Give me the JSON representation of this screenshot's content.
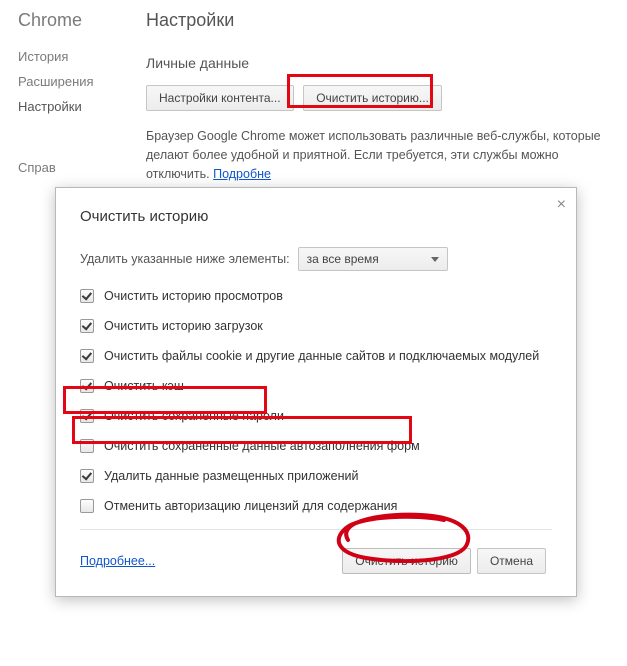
{
  "app_name": "Chrome",
  "page_title": "Настройки",
  "sidebar": {
    "items": [
      {
        "label": "История"
      },
      {
        "label": "Расширения"
      },
      {
        "label": "Настройки"
      }
    ],
    "footer_item": {
      "label": "Справ"
    }
  },
  "personal": {
    "section_title": "Личные данные",
    "btn_content": "Настройки контента...",
    "btn_clear": "Очистить историю...",
    "description_1": "Браузер Google Chrome может использовать различные веб-службы, которые делают",
    "description_2": "более удобной и приятной. Если требуется, эти службы можно отключить. ",
    "more_link": "Подробне"
  },
  "dialog": {
    "title": "Очистить историю",
    "delete_label": "Удалить указанные ниже элементы:",
    "range_value": "за все время",
    "checks": [
      {
        "label": "Очистить историю просмотров",
        "checked": true
      },
      {
        "label": "Очистить историю загрузок",
        "checked": true
      },
      {
        "label": "Очистить файлы cookie и другие данные сайтов и подключаемых модулей",
        "checked": true
      },
      {
        "label": "Очистить кэш",
        "checked": true
      },
      {
        "label": "Очистить сохраненные пароли",
        "checked": true
      },
      {
        "label": "Очистить сохраненные данные автозаполнения форм",
        "checked": false
      },
      {
        "label": "Удалить данные размещенных приложений",
        "checked": true
      },
      {
        "label": "Отменить авторизацию лицензий для содержания",
        "checked": false
      }
    ],
    "more": "Подробнее...",
    "ok": "Очистить историю",
    "cancel": "Отмена"
  }
}
